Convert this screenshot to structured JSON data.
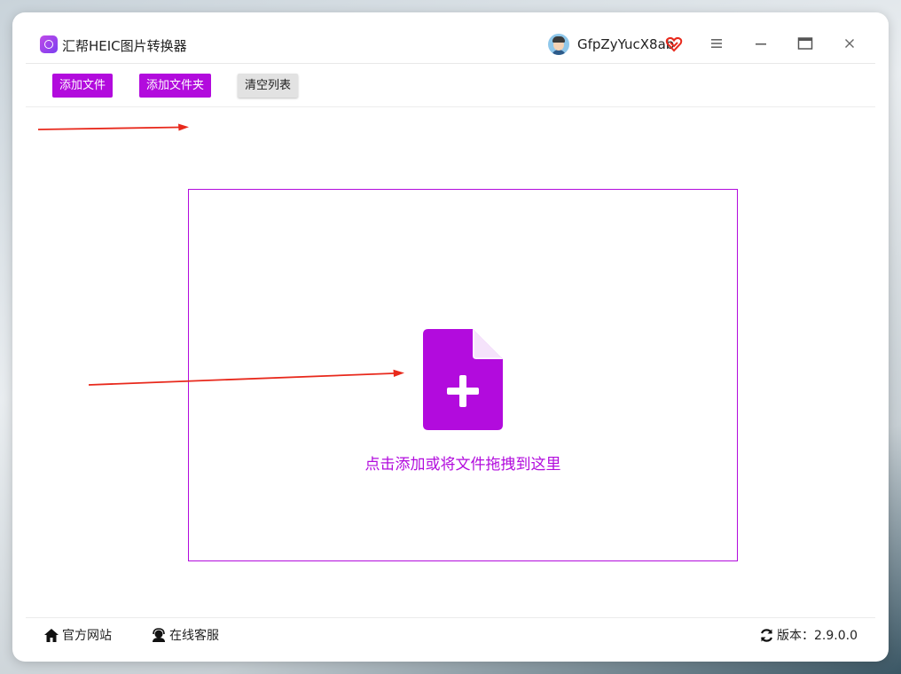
{
  "app": {
    "title": "汇帮HEIC图片转换器",
    "username": "GfpZyYucX8ab"
  },
  "toolbar": {
    "add_file_label": "添加文件",
    "add_folder_label": "添加文件夹",
    "clear_list_label": "清空列表"
  },
  "dropzone": {
    "hint": "点击添加或将文件拖拽到这里"
  },
  "footer": {
    "website_label": "官方网站",
    "support_label": "在线客服",
    "version_label": "版本：2.9.0.0"
  },
  "colors": {
    "accent": "#b20bdd",
    "annotation_arrow": "#e8291c"
  },
  "icons": [
    "app-logo-icon",
    "avatar",
    "vip-heart-icon",
    "menu-icon",
    "minimize-icon",
    "maximize-icon",
    "close-icon",
    "add-file-icon",
    "home-icon",
    "support-agent-icon",
    "refresh-icon"
  ]
}
